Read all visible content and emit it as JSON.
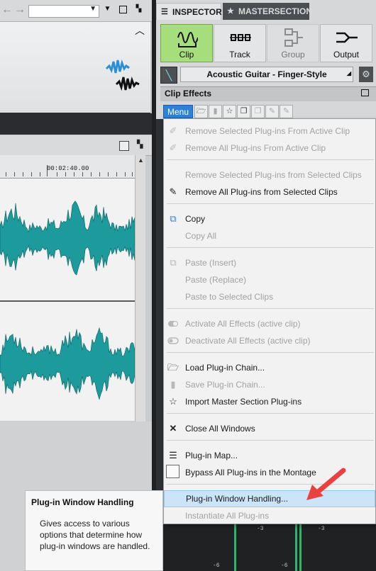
{
  "left_pane": {
    "ruler_time": "00:02:40.00"
  },
  "inspector": {
    "tab_inspector": "INSPECTOR",
    "tab_master": "MASTERSECTION",
    "buttons": [
      {
        "label": "Clip",
        "active": true
      },
      {
        "label": "Track",
        "active": false
      },
      {
        "label": "Group",
        "active": false,
        "disabled": true
      },
      {
        "label": "Output",
        "active": false
      }
    ],
    "preset_name": "Acoustic Guitar - Finger-Style",
    "section_title": "Clip Effects",
    "menu_button": "Menu"
  },
  "menu": {
    "items": [
      {
        "label": "Remove Selected Plug-ins From Active Clip",
        "enabled": false,
        "icon": "eraser-icon"
      },
      {
        "label": "Remove All Plug-ins From Active Clip",
        "enabled": false,
        "icon": "eraser-icon"
      },
      {
        "label": "Remove Selected Plug-ins from Selected Clips",
        "enabled": false,
        "icon": ""
      },
      {
        "label": "Remove All Plug-ins from Selected Clips",
        "enabled": true,
        "icon": "remove-all-icon"
      },
      {
        "label": "Copy",
        "enabled": true,
        "icon": "copy-icon"
      },
      {
        "label": "Copy All",
        "enabled": false,
        "icon": ""
      },
      {
        "label": "Paste (Insert)",
        "enabled": false,
        "icon": "paste-icon"
      },
      {
        "label": "Paste (Replace)",
        "enabled": false,
        "icon": ""
      },
      {
        "label": "Paste to Selected Clips",
        "enabled": false,
        "icon": ""
      },
      {
        "label": "Activate All Effects (active clip)",
        "enabled": false,
        "icon": "toggle-on-icon"
      },
      {
        "label": "Deactivate All Effects (active clip)",
        "enabled": false,
        "icon": "toggle-off-icon"
      },
      {
        "label": "Load Plug-in Chain...",
        "enabled": true,
        "icon": "folder-icon"
      },
      {
        "label": "Save Plug-in Chain...",
        "enabled": false,
        "icon": "save-icon"
      },
      {
        "label": "Import Master Section Plug-ins",
        "enabled": true,
        "icon": "star-icon"
      },
      {
        "label": "Close All Windows",
        "enabled": true,
        "icon": "close-icon"
      },
      {
        "label": "Plug-in Map...",
        "enabled": true,
        "icon": "list-icon"
      },
      {
        "label": "Bypass All Plug-ins in the Montage",
        "enabled": true,
        "icon": "checkbox-icon"
      },
      {
        "label": "Plug-in Window Handling...",
        "enabled": true,
        "icon": "",
        "highlighted": true
      },
      {
        "label": "Instantiate All Plug-ins",
        "enabled": false,
        "icon": ""
      }
    ]
  },
  "tooltip": {
    "title": "Plug-in Window Handling",
    "description": "Gives access to various options that determine how plug-in windows are handled."
  },
  "meter": {
    "labels": [
      "-3",
      "-3",
      "-6",
      "-6"
    ]
  },
  "colors": {
    "accent_blue": "#2b82d6",
    "clip_active_green": "#a7de7d",
    "waveform_teal": "#1d9a9c",
    "arrow_red": "#e8413f"
  }
}
